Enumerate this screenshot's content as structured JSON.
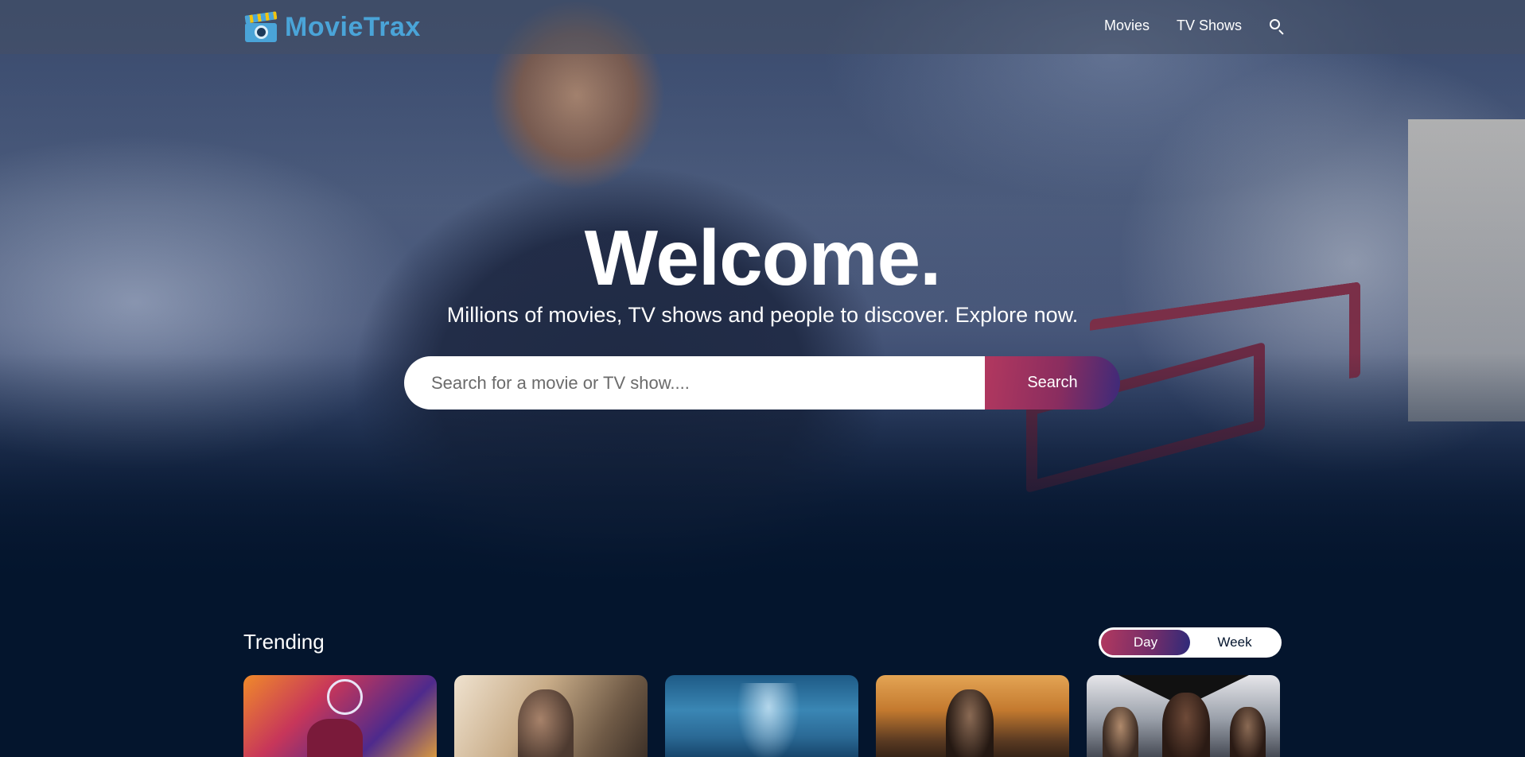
{
  "header": {
    "logo_text": "MovieTrax",
    "nav": [
      {
        "label": "Movies"
      },
      {
        "label": "TV Shows"
      }
    ]
  },
  "hero": {
    "title": "Welcome.",
    "subtitle": "Millions of movies, TV shows and people to discover. Explore now.",
    "search": {
      "placeholder": "Search for a movie or TV show....",
      "button_label": "Search"
    }
  },
  "trending": {
    "title": "Trending",
    "tabs": [
      {
        "label": "Day",
        "active": true
      },
      {
        "label": "Week",
        "active": false
      }
    ]
  },
  "colors": {
    "background": "#04152d",
    "logo": "#4aa4d8",
    "accent_start": "#b2385f",
    "accent_end": "#3c2a7a"
  },
  "icons": {
    "logo": "camera-clapper-icon",
    "search": "search-icon"
  }
}
